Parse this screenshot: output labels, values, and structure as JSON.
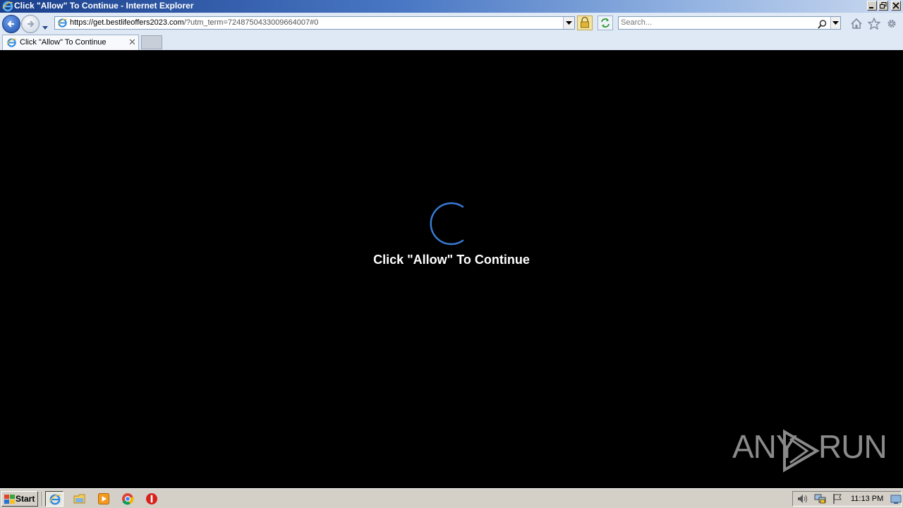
{
  "window": {
    "title": "Click \"Allow\" To Continue - Internet Explorer",
    "icon": "ie-logo-icon"
  },
  "address_bar": {
    "url_host": "https://get.bestlifeoffers2023.com",
    "url_rest": "/?utm_term=7248750433009664007#0"
  },
  "search": {
    "placeholder": "Search..."
  },
  "tabs": [
    {
      "label": "Click \"Allow\" To Continue",
      "active": true
    }
  ],
  "page": {
    "message": "Click \"Allow\" To Continue",
    "spinner_color": "#3a7bd5"
  },
  "watermark": {
    "left": "ANY",
    "right": "RUN"
  },
  "taskbar": {
    "start_label": "Start",
    "pinned": [
      "internet-explorer-icon",
      "file-explorer-icon",
      "media-player-icon",
      "chrome-icon",
      "stop-sign-icon"
    ],
    "clock": "11:13 PM"
  },
  "colors": {
    "titlebar_start": "#1a3f8c",
    "page_background": "#000000",
    "message_text": "#ffffff",
    "watermark": "#8a8a8a"
  }
}
